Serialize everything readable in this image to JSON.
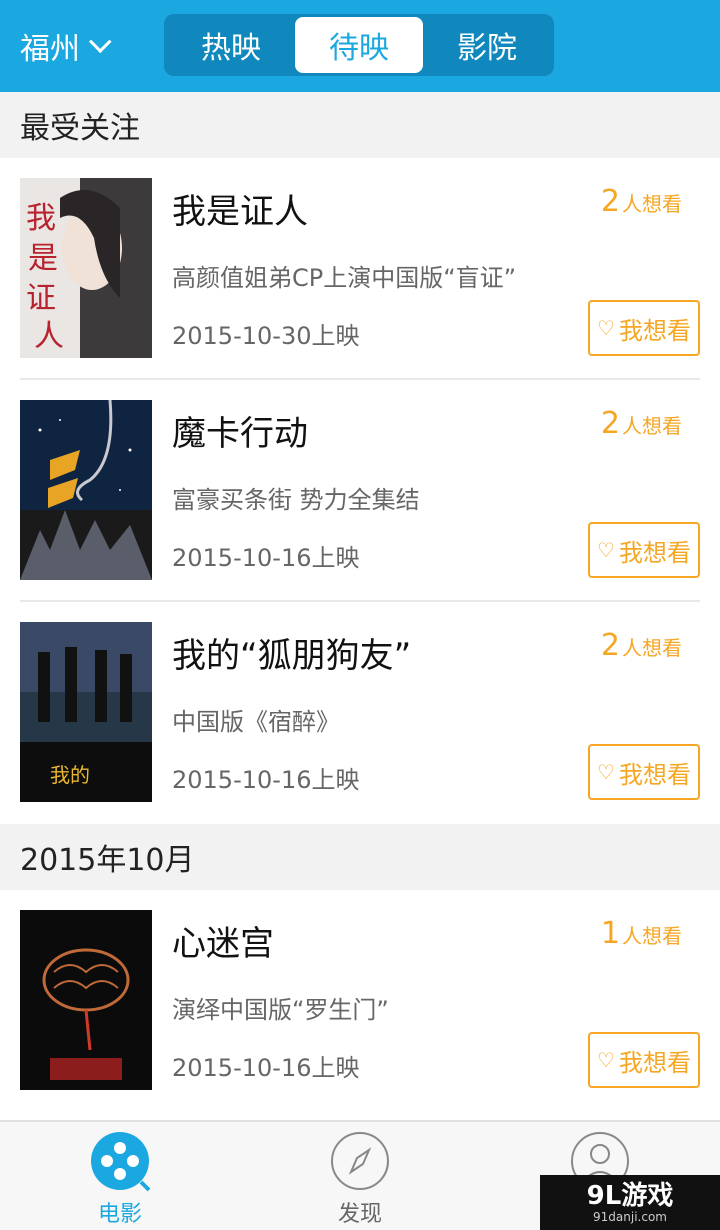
{
  "header": {
    "city": "福州",
    "tabs": [
      {
        "label": "热映",
        "active": false
      },
      {
        "label": "待映",
        "active": true
      },
      {
        "label": "影院",
        "active": false
      }
    ]
  },
  "sections": {
    "featured": "最受关注",
    "month": "2015年10月"
  },
  "movies": [
    {
      "title": "我是证人",
      "desc": "高颜值姐弟CP上演中国版“盲证”",
      "date": "2015-10-30上映",
      "want_count": "2",
      "want_unit": "人想看",
      "want_button": "我想看"
    },
    {
      "title": "魔卡行动",
      "desc": "富豪买条街 势力全集结",
      "date": "2015-10-16上映",
      "want_count": "2",
      "want_unit": "人想看",
      "want_button": "我想看"
    },
    {
      "title": "我的“狐朋狗友”",
      "desc": "中国版《宿醉》",
      "date": "2015-10-16上映",
      "want_count": "2",
      "want_unit": "人想看",
      "want_button": "我想看"
    },
    {
      "title": "心迷宫",
      "desc": "演绎中国版“罗生门”",
      "date": "2015-10-16上映",
      "want_count": "1",
      "want_unit": "人想看",
      "want_button": "我想看"
    }
  ],
  "bottom_nav": [
    {
      "label": "电影",
      "icon": "film-reel-icon",
      "active": true
    },
    {
      "label": "发现",
      "icon": "compass-icon",
      "active": false
    },
    {
      "label": "",
      "icon": "user-icon",
      "active": false
    }
  ],
  "watermark": {
    "big": "9L游戏",
    "small": "91danji.com"
  },
  "colors": {
    "primary": "#1ba8e0",
    "accent": "#f5a623",
    "tab_bg": "#1087bd"
  }
}
